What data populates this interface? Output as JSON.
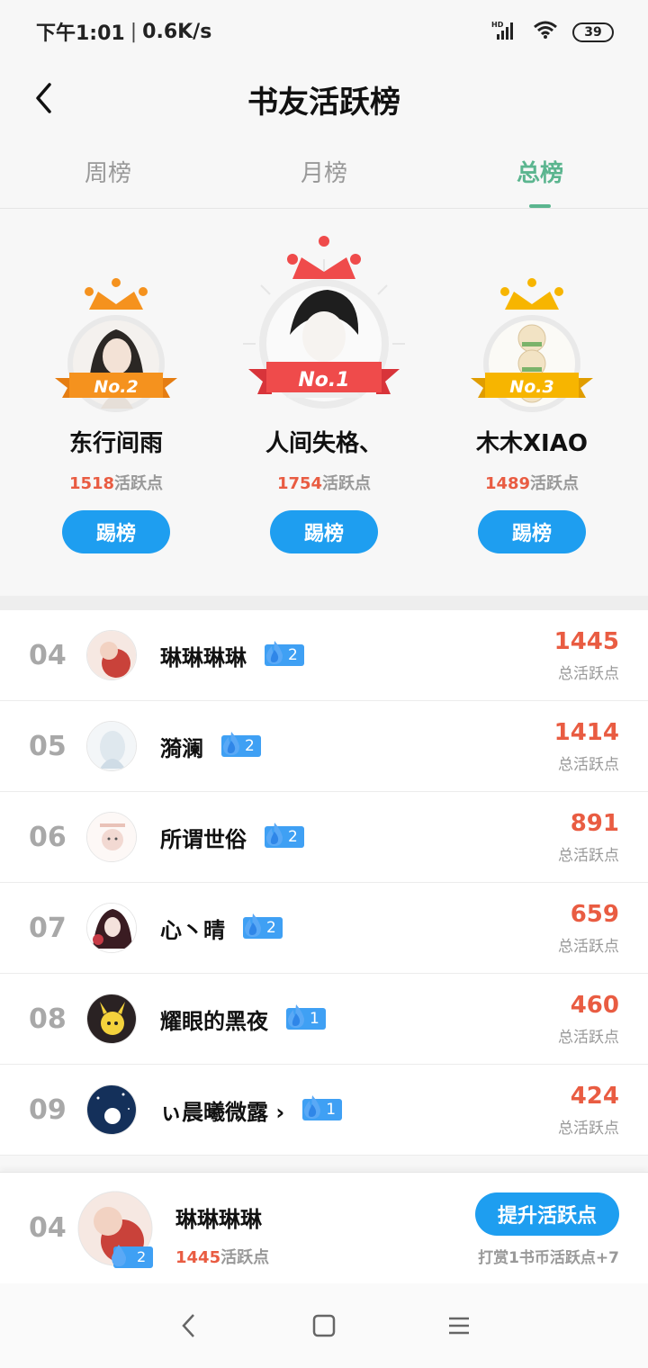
{
  "status": {
    "time": "下午1:01",
    "speed": "0.6K/s",
    "network": "HD",
    "battery": "39"
  },
  "header": {
    "title": "书友活跃榜"
  },
  "tabs": [
    {
      "label": "周榜",
      "active": false
    },
    {
      "label": "月榜",
      "active": false
    },
    {
      "label": "总榜",
      "active": true
    }
  ],
  "podium": {
    "first": {
      "rank_label": "No.1",
      "name": "人间失格、",
      "points": "1754",
      "points_suffix": "活跃点",
      "button": "踢榜"
    },
    "second": {
      "rank_label": "No.2",
      "name": "东行间雨",
      "points": "1518",
      "points_suffix": "活跃点",
      "button": "踢榜"
    },
    "third": {
      "rank_label": "No.3",
      "name": "木木XIAO",
      "points": "1489",
      "points_suffix": "活跃点",
      "button": "踢榜"
    }
  },
  "list": [
    {
      "rank": "04",
      "name": "琳琳琳琳",
      "level": "2",
      "score": "1445",
      "score_label": "总活跃点"
    },
    {
      "rank": "05",
      "name": "漪澜",
      "level": "2",
      "score": "1414",
      "score_label": "总活跃点"
    },
    {
      "rank": "06",
      "name": "所谓世俗",
      "level": "2",
      "score": "891",
      "score_label": "总活跃点"
    },
    {
      "rank": "07",
      "name": "心丶晴",
      "level": "2",
      "score": "659",
      "score_label": "总活跃点"
    },
    {
      "rank": "08",
      "name": "耀眼的黑夜",
      "level": "1",
      "score": "460",
      "score_label": "总活跃点"
    },
    {
      "rank": "09",
      "name": "ぃ晨曦微露 ›",
      "level": "1",
      "score": "424",
      "score_label": "总活跃点"
    }
  ],
  "my_rank": {
    "rank": "04",
    "name": "琳琳琳琳",
    "level": "2",
    "points": "1445",
    "points_suffix": "活跃点",
    "button": "提升活跃点",
    "hint": "打赏1书币活跃点+7"
  },
  "colors": {
    "accent_green": "#5bb58f",
    "button_blue": "#1e9ef0",
    "score_red": "#e95c42",
    "crown_red": "#ef4b4b",
    "crown_orange": "#f5921e",
    "crown_yellow": "#f7b500"
  }
}
